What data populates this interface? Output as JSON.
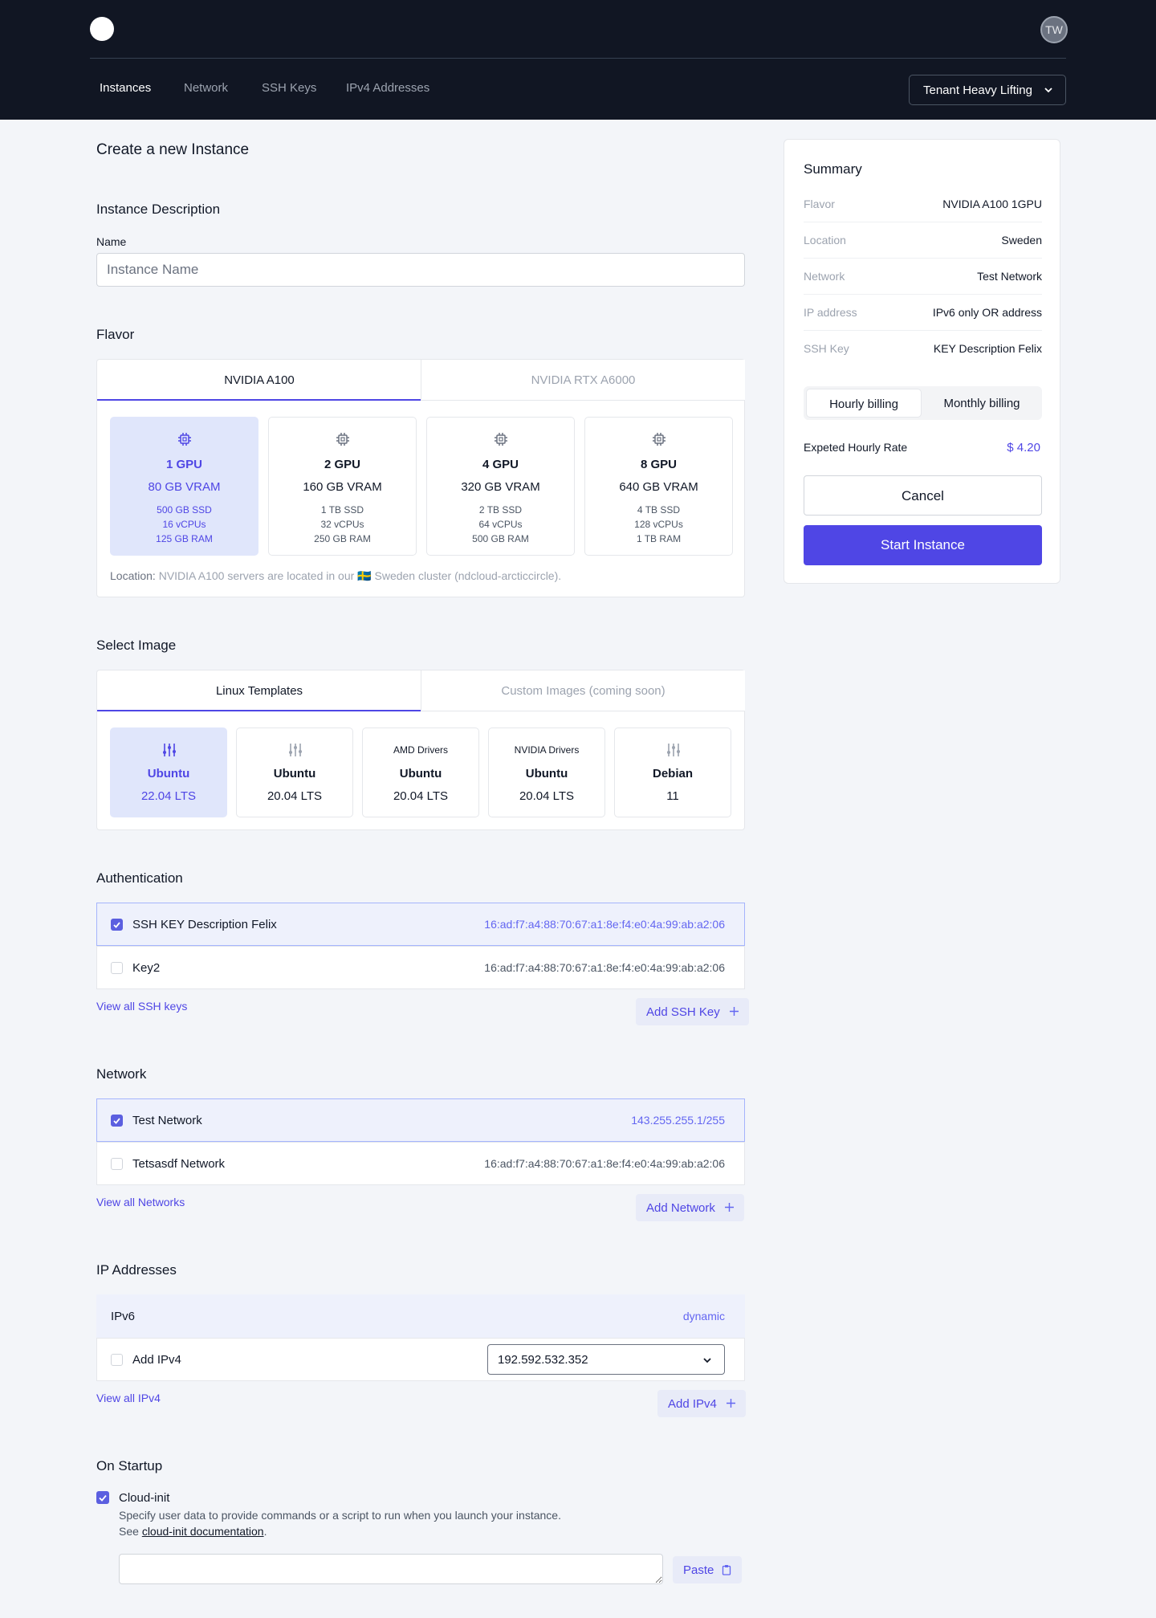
{
  "header": {
    "avatar_initials": "TW",
    "nav": [
      "Instances",
      "Network",
      "SSH Keys",
      "IPv4 Addresses"
    ],
    "tenant": "Tenant Heavy Lifting"
  },
  "page_title": "Create a new Instance",
  "description": {
    "title": "Instance Description",
    "name_label": "Name",
    "name_placeholder": "Instance Name"
  },
  "flavor": {
    "title": "Flavor",
    "tabs": [
      "NVIDIA A100",
      "NVIDIA RTX A6000"
    ],
    "options": [
      {
        "gpu": "1 GPU",
        "vram": "80 GB VRAM",
        "ssd": "500 GB SSD",
        "cpu": "16 vCPUs",
        "ram": "125 GB RAM",
        "selected": true
      },
      {
        "gpu": "2 GPU",
        "vram": "160 GB VRAM",
        "ssd": "1 TB SSD",
        "cpu": "32 vCPUs",
        "ram": "250 GB RAM",
        "selected": false
      },
      {
        "gpu": "4 GPU",
        "vram": "320 GB VRAM",
        "ssd": "2 TB SSD",
        "cpu": "64 vCPUs",
        "ram": "500 GB RAM",
        "selected": false
      },
      {
        "gpu": "8 GPU",
        "vram": "640 GB VRAM",
        "ssd": "4 TB SSD",
        "cpu": "128 vCPUs",
        "ram": "1 TB RAM",
        "selected": false
      }
    ],
    "location_label": "Location:",
    "location_text": "NVIDIA A100 servers are located in our 🇸🇪 Sweden cluster (ndcloud-arcticcircle)."
  },
  "image": {
    "title": "Select Image",
    "tabs": [
      "Linux Templates",
      "Custom Images (coming soon)"
    ],
    "options": [
      {
        "badge": "",
        "name": "Ubuntu",
        "version": "22.04 LTS",
        "selected": true
      },
      {
        "badge": "",
        "name": "Ubuntu",
        "version": "20.04 LTS",
        "selected": false
      },
      {
        "badge": "AMD Drivers",
        "name": "Ubuntu",
        "version": "20.04 LTS",
        "selected": false
      },
      {
        "badge": "NVIDIA Drivers",
        "name": "Ubuntu",
        "version": "20.04 LTS",
        "selected": false
      },
      {
        "badge": "",
        "name": "Debian",
        "version": "11",
        "selected": false
      }
    ]
  },
  "authentication": {
    "title": "Authentication",
    "keys": [
      {
        "name": "SSH KEY Description Felix",
        "fingerprint": "16:ad:f7:a4:88:70:67:a1:8e:f4:e0:4a:99:ab:a2:06",
        "checked": true
      },
      {
        "name": "Key2",
        "fingerprint": "16:ad:f7:a4:88:70:67:a1:8e:f4:e0:4a:99:ab:a2:06",
        "checked": false
      }
    ],
    "view_all": "View all SSH keys",
    "add": "Add SSH Key"
  },
  "network": {
    "title": "Network",
    "items": [
      {
        "name": "Test Network",
        "value": "143.255.255.1/255",
        "checked": true
      },
      {
        "name": "Tetsasdf Network",
        "value": "16:ad:f7:a4:88:70:67:a1:8e:f4:e0:4a:99:ab:a2:06",
        "checked": false
      }
    ],
    "view_all": "View all Networks",
    "add": "Add Network"
  },
  "ip": {
    "title": "IP Addresses",
    "ipv6_label": "IPv6",
    "ipv6_value": "dynamic",
    "ipv4_label": "Add IPv4",
    "ipv4_selected": "192.592.532.352",
    "view_all": "View all IPv4",
    "add": "Add IPv4"
  },
  "startup": {
    "title": "On Startup",
    "cloud_init": "Cloud-init",
    "desc": "Specify user data to provide commands or a script to run when you launch your instance.",
    "see": "See",
    "doc_link": "cloud-init documentation",
    "paste": "Paste"
  },
  "summary": {
    "title": "Summary",
    "rows": [
      {
        "k": "Flavor",
        "v": "NVIDIA A100 1GPU"
      },
      {
        "k": "Location",
        "v": "Sweden"
      },
      {
        "k": "Network",
        "v": "Test Network"
      },
      {
        "k": "IP address",
        "v": "IPv6 only OR address"
      },
      {
        "k": "SSH Key",
        "v": "KEY Description Felix"
      }
    ],
    "billing": [
      "Hourly billing",
      "Monthly billing"
    ],
    "rate_label": "Expeted Hourly Rate",
    "rate_value": "$ 4.20",
    "cancel": "Cancel",
    "start": "Start Instance"
  },
  "colors": {
    "accent": "#4f46e5",
    "header_bg": "#111623",
    "page_bg": "#f3f5f9"
  }
}
